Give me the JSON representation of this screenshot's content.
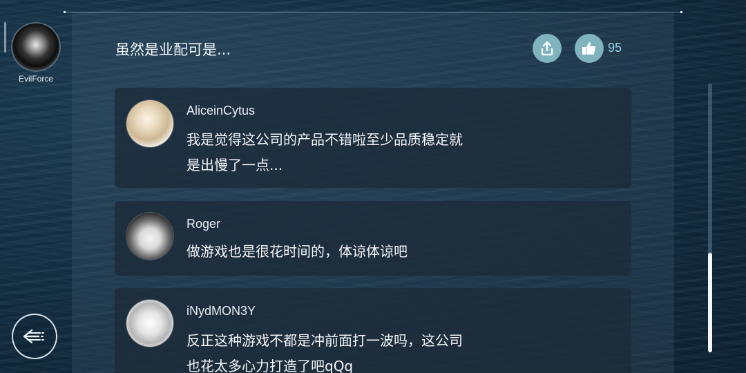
{
  "sidebar": {
    "profile_name": "EvilForce"
  },
  "post": {
    "title": "虽然是业配可是...",
    "like_count": "95",
    "share_icon": "share-icon",
    "like_icon": "thumbs-up-icon"
  },
  "comments": [
    {
      "username": "AliceinCytus",
      "line1": "我是觉得这公司的产品不错啦至少品质稳定就",
      "line2": "是出慢了一点..."
    },
    {
      "username": "Roger",
      "line1": "做游戏也是很花时间的，体谅体谅吧"
    },
    {
      "username": "iNydMON3Y",
      "line1": "反正这种游戏不都是冲前面打一波吗，这公司",
      "line2": "也花太多心力打造了吧qQq"
    }
  ],
  "navigation": {
    "back_icon": "back-arrow-icon"
  },
  "colors": {
    "accent": "#7fb3be",
    "like_count": "#8fd3e4",
    "card_bg": "#1c2a38"
  }
}
